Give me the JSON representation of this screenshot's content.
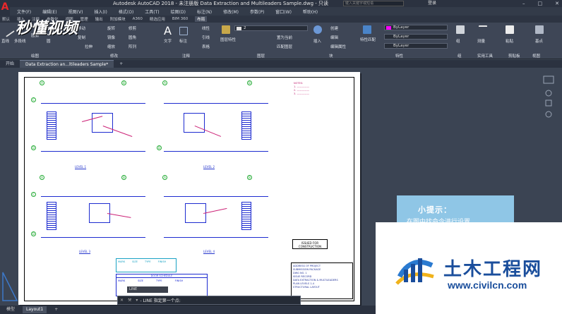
{
  "window": {
    "title": "Autodesk AutoCAD 2018 - 未注册版   Data Extraction and Multileaders Sample.dwg - 只读",
    "search_placeholder": "键入关键字或短语",
    "login": "登录"
  },
  "menubar": [
    "文件(F)",
    "编辑(E)",
    "视图(V)",
    "插入(I)",
    "格式(O)",
    "工具(T)",
    "绘图(D)",
    "标注(N)",
    "修改(M)",
    "参数(P)",
    "窗口(W)",
    "帮助(H)"
  ],
  "ribbon_tabs": [
    "默认",
    "插入",
    "注释",
    "参数化",
    "视图",
    "管理",
    "输出",
    "附加模块",
    "A360",
    "精选应用",
    "BIM 360",
    "布局"
  ],
  "ribbon_tabs_active_index": 11,
  "ribbon": {
    "draw_tools": [
      "直线",
      "多段线",
      "圆弧",
      "圆"
    ],
    "modify_tools": [
      "移动",
      "旋转",
      "修剪",
      "复制",
      "镜像",
      "圆角",
      "拉伸",
      "缩放",
      "阵列"
    ],
    "text": "文字",
    "dimension": "标注",
    "annotation_tools": [
      "线性",
      "引线",
      "表格"
    ],
    "layer_combo": "2",
    "layer_buttons": [
      "图层特性",
      "置为当前",
      "匹配图层"
    ],
    "insert": "插入",
    "block_tools": [
      "创建",
      "编辑",
      "编辑属性"
    ],
    "match_properties": "特性匹配",
    "property_combos": [
      "ByLayer",
      "ByLayer",
      "ByLayer"
    ],
    "measure": "测量",
    "group": "组",
    "paste": "粘贴",
    "base": "基点",
    "groups": [
      "绘图",
      "修改",
      "注释",
      "图层",
      "块",
      "特性",
      "组",
      "实用工具",
      "剪贴板",
      "视图"
    ]
  },
  "doc_tabs": [
    "开始",
    "Data Extraction an...ltileaders Sample*"
  ],
  "drawing": {
    "level_labels": [
      "LEVEL 1",
      "LEVEL 2",
      "LEVEL 3",
      "LEVEL 4"
    ],
    "grid_letters": [
      "A",
      "B",
      "C",
      "D"
    ],
    "stamp": [
      "ISSUED FOR",
      "CONSTRUCTION"
    ],
    "titleblock": [
      "ADDRESS OF PROJECT",
      "SUBMISSION PACKAGE",
      "DWG NO. 1",
      "ISSUE RECORD",
      "DATA EXTRACTION & MULTILEADERS",
      "PLAN LEVELS 1-4",
      "STRUCTURAL LAYOUT"
    ],
    "schedule_title": "DOOR SCHEDULE",
    "schedule_headers": [
      "MARK",
      "SIZE",
      "TYPE",
      "FINISH"
    ]
  },
  "command": {
    "history": "LINE",
    "prompt": "- LINE 指定第一个点:"
  },
  "status_tabs": [
    "模型",
    "Layout1"
  ],
  "watermark": "秒懂视频",
  "tip": {
    "title": "小提示：",
    "body": "在图中找命令进行设置"
  },
  "site_logo": {
    "name": "土木工程网",
    "url": "www.civilcn.com"
  },
  "colors": {
    "accent_red": "#e8282b",
    "plan_blue": "#1d2bd0",
    "leader_magenta": "#cc2277",
    "grid_green": "#22aa33",
    "logo_blue": "#1a4e9c",
    "tip_blue": "#8fc6e6"
  }
}
